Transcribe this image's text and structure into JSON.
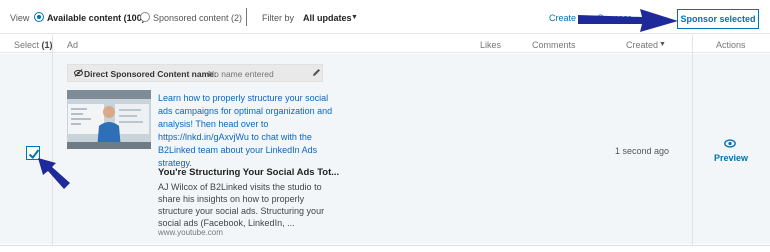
{
  "topbar": {
    "view_label": "View",
    "available_label": "Available content (100)",
    "sponsored_label": "Sponsored content (2)",
    "filter_label": "Filter by",
    "filter_value": "All updates",
    "create_link": "Create new Sponsor",
    "sponsor_button": "Sponsor selected"
  },
  "columns": {
    "select_prefix": "Select",
    "select_count": "(1)",
    "ad": "Ad",
    "likes": "Likes",
    "comments": "Comments",
    "created": "Created",
    "actions": "Actions"
  },
  "row": {
    "selected": true,
    "name_label": "Direct Sponsored Content name:",
    "name_placeholder": "No name entered",
    "description": "Learn how to properly structure your social ads campaigns for optimal organization and analysis! Then head over to https://lnkd.in/gAxvjWu to chat with the B2Linked team about your LinkedIn Ads strategy.",
    "link_title": "You're Structuring Your Social Ads Tot...",
    "link_summary": "AJ Wilcox of B2Linked visits the studio to share his insights on how to properly structure your social ads. Structuring your social ads (Facebook, LinkedIn, ...",
    "link_domain": "www.youtube.com",
    "created": "1 second ago",
    "preview_label": "Preview"
  },
  "colors": {
    "accent": "#0073b1",
    "annotation_arrow": "#1f2a9a"
  },
  "icons": [
    "radio-checked",
    "radio-unchecked",
    "chevron-down-icon",
    "eye-slash-icon",
    "pencil-icon",
    "checkmark-icon",
    "eye-icon",
    "annotation-arrow"
  ]
}
